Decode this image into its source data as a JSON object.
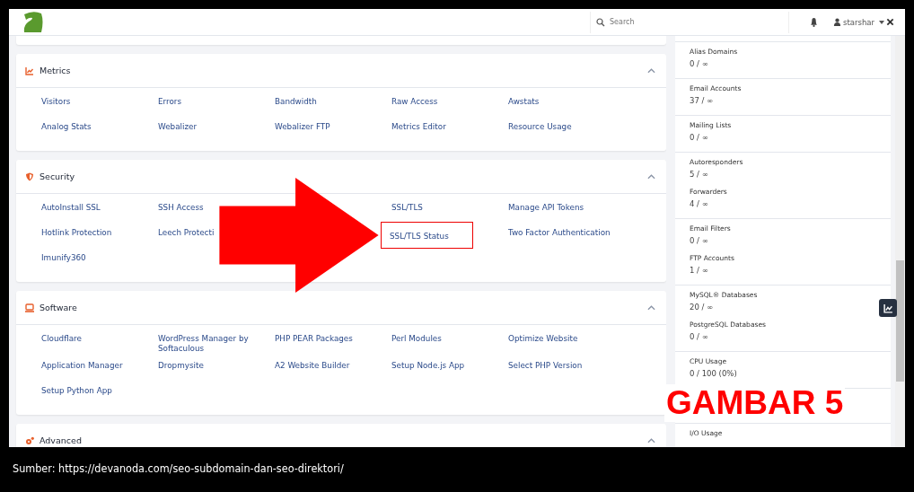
{
  "header": {
    "search": {
      "placeholder": "Search"
    },
    "user": "starshar"
  },
  "sections": [
    {
      "title": "Metrics",
      "items": [
        {
          "label": "Visitors",
          "highlighted": false
        },
        {
          "label": "Errors",
          "highlighted": false
        },
        {
          "label": "Bandwidth",
          "highlighted": false
        },
        {
          "label": "Raw Access",
          "highlighted": false
        },
        {
          "label": "Awstats",
          "highlighted": false
        },
        {
          "label": "Analog Stats",
          "highlighted": false
        },
        {
          "label": "Webalizer",
          "highlighted": false
        },
        {
          "label": "Webalizer FTP",
          "highlighted": false
        },
        {
          "label": "Metrics Editor",
          "highlighted": false
        },
        {
          "label": "Resource Usage",
          "highlighted": false
        }
      ]
    },
    {
      "title": "Security",
      "items": [
        {
          "label": "AutoInstall SSL",
          "highlighted": false
        },
        {
          "label": "SSH Access",
          "highlighted": false
        },
        {
          "label": "SSL/TLS",
          "highlighted": false
        },
        {
          "label": "Manage API Tokens",
          "highlighted": false
        },
        {
          "label": "Hotlink Protection",
          "highlighted": false
        },
        {
          "label": "Leech Protecti",
          "highlighted": false
        },
        {
          "label": "SSL/TLS Status",
          "highlighted": true
        },
        {
          "label": "Two Factor Authentication",
          "highlighted": false
        },
        {
          "label": "Imunify360",
          "highlighted": false
        }
      ]
    },
    {
      "title": "Software",
      "items": [
        {
          "label": "Cloudflare",
          "highlighted": false
        },
        {
          "label": "WordPress Manager by Softaculous",
          "highlighted": false
        },
        {
          "label": "PHP PEAR Packages",
          "highlighted": false
        },
        {
          "label": "Perl Modules",
          "highlighted": false
        },
        {
          "label": "Optimize Website",
          "highlighted": false
        },
        {
          "label": "Application Manager",
          "highlighted": false
        },
        {
          "label": "Dropmysite",
          "highlighted": false
        },
        {
          "label": "A2 Website Builder",
          "highlighted": false
        },
        {
          "label": "Setup Node.js App",
          "highlighted": false
        },
        {
          "label": "Select PHP Version",
          "highlighted": false
        },
        {
          "label": "Setup Python App",
          "highlighted": false
        }
      ]
    },
    {
      "title": "Advanced"
    }
  ],
  "stats": [
    [
      {
        "label": "Alias Domains",
        "value": "0 / ∞"
      }
    ],
    [
      {
        "label": "Email Accounts",
        "value": "37 / ∞"
      }
    ],
    [
      {
        "label": "Mailing Lists",
        "value": "0 / ∞"
      }
    ],
    [
      {
        "label": "Autoresponders",
        "value": "5 / ∞"
      },
      {
        "label": "Forwarders",
        "value": "4 / ∞"
      }
    ],
    [
      {
        "label": "Email Filters",
        "value": "0 / ∞"
      },
      {
        "label": "FTP Accounts",
        "value": "1 / ∞"
      }
    ],
    [
      {
        "label": "MySQL® Databases",
        "value": "20 / ∞"
      },
      {
        "label": "PostgreSQL Databases",
        "value": "0 / ∞"
      }
    ],
    [
      {
        "label": "CPU Usage",
        "value": "0 / 100   (0%)"
      }
    ],
    [
      {
        "label": "I/O Usage"
      }
    ]
  ],
  "annotation": {
    "label": "GAMBAR 5"
  },
  "caption": "Sumber:  https://devanoda.com/seo-subdomain-dan-seo-direktori/"
}
